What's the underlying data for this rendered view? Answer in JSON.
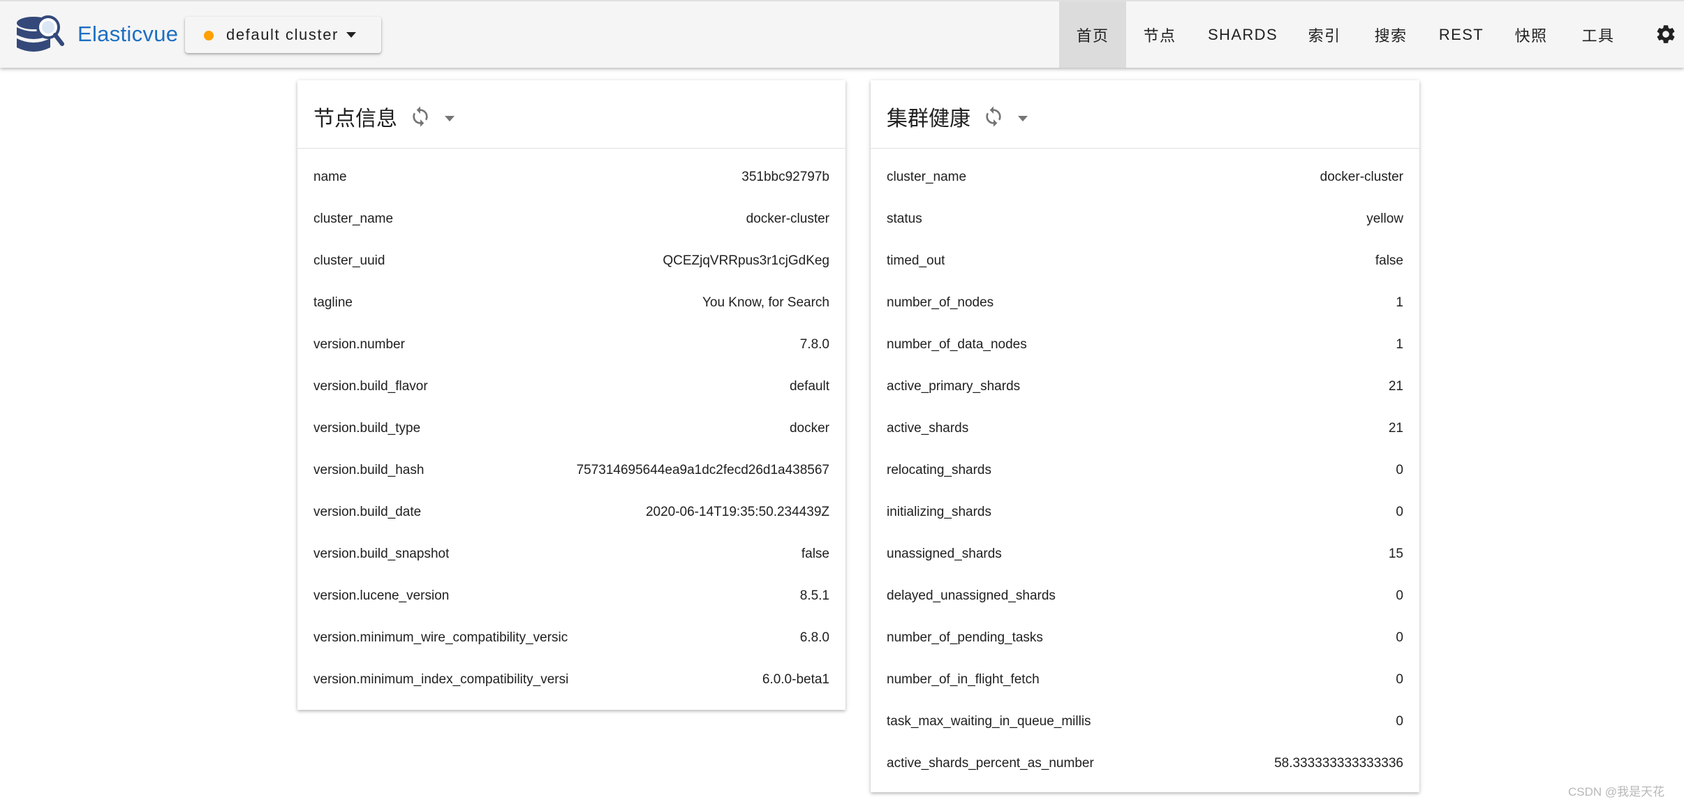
{
  "app": {
    "brand": "Elasticvue",
    "cluster_selector": {
      "label": "default cluster",
      "status_color": "#ffa000"
    },
    "accent_color": "#1e6fc2"
  },
  "nav": [
    {
      "label": "首页",
      "active": true
    },
    {
      "label": "节点",
      "active": false
    },
    {
      "label": "SHARDS",
      "active": false
    },
    {
      "label": "索引",
      "active": false
    },
    {
      "label": "搜索",
      "active": false
    },
    {
      "label": "REST",
      "active": false
    },
    {
      "label": "快照",
      "active": false
    },
    {
      "label": "工具",
      "active": false
    }
  ],
  "settings_icon": "gear-icon",
  "node_info": {
    "title": "节点信息",
    "rows": [
      {
        "key": "name",
        "value": "351bbc92797b"
      },
      {
        "key": "cluster_name",
        "value": "docker-cluster"
      },
      {
        "key": "cluster_uuid",
        "value": "QCEZjqVRRpus3r1cjGdKeg"
      },
      {
        "key": "tagline",
        "value": "You Know, for Search"
      },
      {
        "key": "version.number",
        "value": "7.8.0"
      },
      {
        "key": "version.build_flavor",
        "value": "default"
      },
      {
        "key": "version.build_type",
        "value": "docker"
      },
      {
        "key": "version.build_hash",
        "value": "757314695644ea9a1dc2fecd26d1a438567"
      },
      {
        "key": "version.build_date",
        "value": "2020-06-14T19:35:50.234439Z"
      },
      {
        "key": "version.build_snapshot",
        "value": "false"
      },
      {
        "key": "version.lucene_version",
        "value": "8.5.1"
      },
      {
        "key": "version.minimum_wire_compatibility_versic",
        "value": "6.8.0"
      },
      {
        "key": "version.minimum_index_compatibility_versi",
        "value": "6.0.0-beta1"
      }
    ]
  },
  "cluster_health": {
    "title": "集群健康",
    "rows": [
      {
        "key": "cluster_name",
        "value": "docker-cluster"
      },
      {
        "key": "status",
        "value": "yellow"
      },
      {
        "key": "timed_out",
        "value": "false"
      },
      {
        "key": "number_of_nodes",
        "value": "1"
      },
      {
        "key": "number_of_data_nodes",
        "value": "1"
      },
      {
        "key": "active_primary_shards",
        "value": "21"
      },
      {
        "key": "active_shards",
        "value": "21"
      },
      {
        "key": "relocating_shards",
        "value": "0"
      },
      {
        "key": "initializing_shards",
        "value": "0"
      },
      {
        "key": "unassigned_shards",
        "value": "15"
      },
      {
        "key": "delayed_unassigned_shards",
        "value": "0"
      },
      {
        "key": "number_of_pending_tasks",
        "value": "0"
      },
      {
        "key": "number_of_in_flight_fetch",
        "value": "0"
      },
      {
        "key": "task_max_waiting_in_queue_millis",
        "value": "0"
      },
      {
        "key": "active_shards_percent_as_number",
        "value": "58.333333333333336"
      }
    ]
  },
  "watermark": "CSDN @我是天花"
}
